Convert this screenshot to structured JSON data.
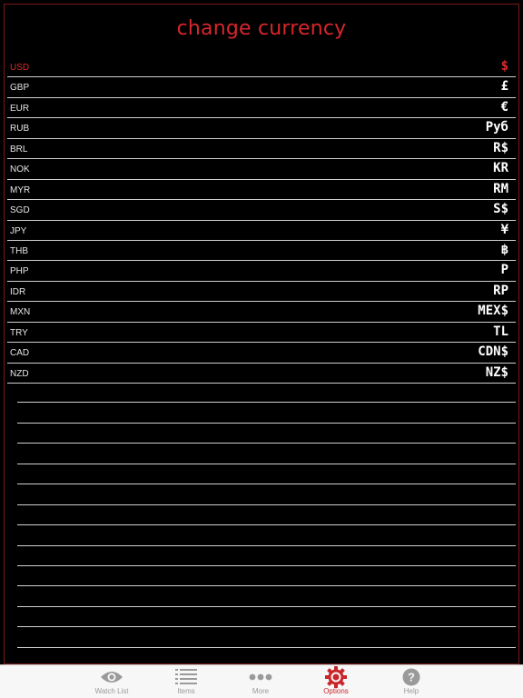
{
  "header": {
    "title": "change currency"
  },
  "currencies": [
    {
      "code": "USD",
      "symbol": "$",
      "selected": true
    },
    {
      "code": "GBP",
      "symbol": "£"
    },
    {
      "code": "EUR",
      "symbol": "€"
    },
    {
      "code": "RUB",
      "symbol": "Руб"
    },
    {
      "code": "BRL",
      "symbol": "R$"
    },
    {
      "code": "NOK",
      "symbol": "KR"
    },
    {
      "code": "MYR",
      "symbol": "RM"
    },
    {
      "code": "SGD",
      "symbol": "S$"
    },
    {
      "code": "JPY",
      "symbol": "¥"
    },
    {
      "code": "THB",
      "symbol": "฿"
    },
    {
      "code": "PHP",
      "symbol": "P"
    },
    {
      "code": "IDR",
      "symbol": "RP"
    },
    {
      "code": "MXN",
      "symbol": "MEX$"
    },
    {
      "code": "TRY",
      "symbol": "TL"
    },
    {
      "code": "CAD",
      "symbol": "CDN$"
    },
    {
      "code": "NZD",
      "symbol": "NZ$"
    }
  ],
  "tabs": [
    {
      "label": "Watch List",
      "icon": "eye-icon"
    },
    {
      "label": "Items",
      "icon": "list-icon"
    },
    {
      "label": "More",
      "icon": "more-dots-icon"
    },
    {
      "label": "Options",
      "icon": "gear-icon",
      "active": true
    },
    {
      "label": "Help",
      "icon": "help-icon"
    }
  ],
  "colors": {
    "accent": "#d8262c",
    "background": "#000000",
    "tabbar": "#f7f7f7",
    "tab_inactive": "#9a9a9a"
  }
}
